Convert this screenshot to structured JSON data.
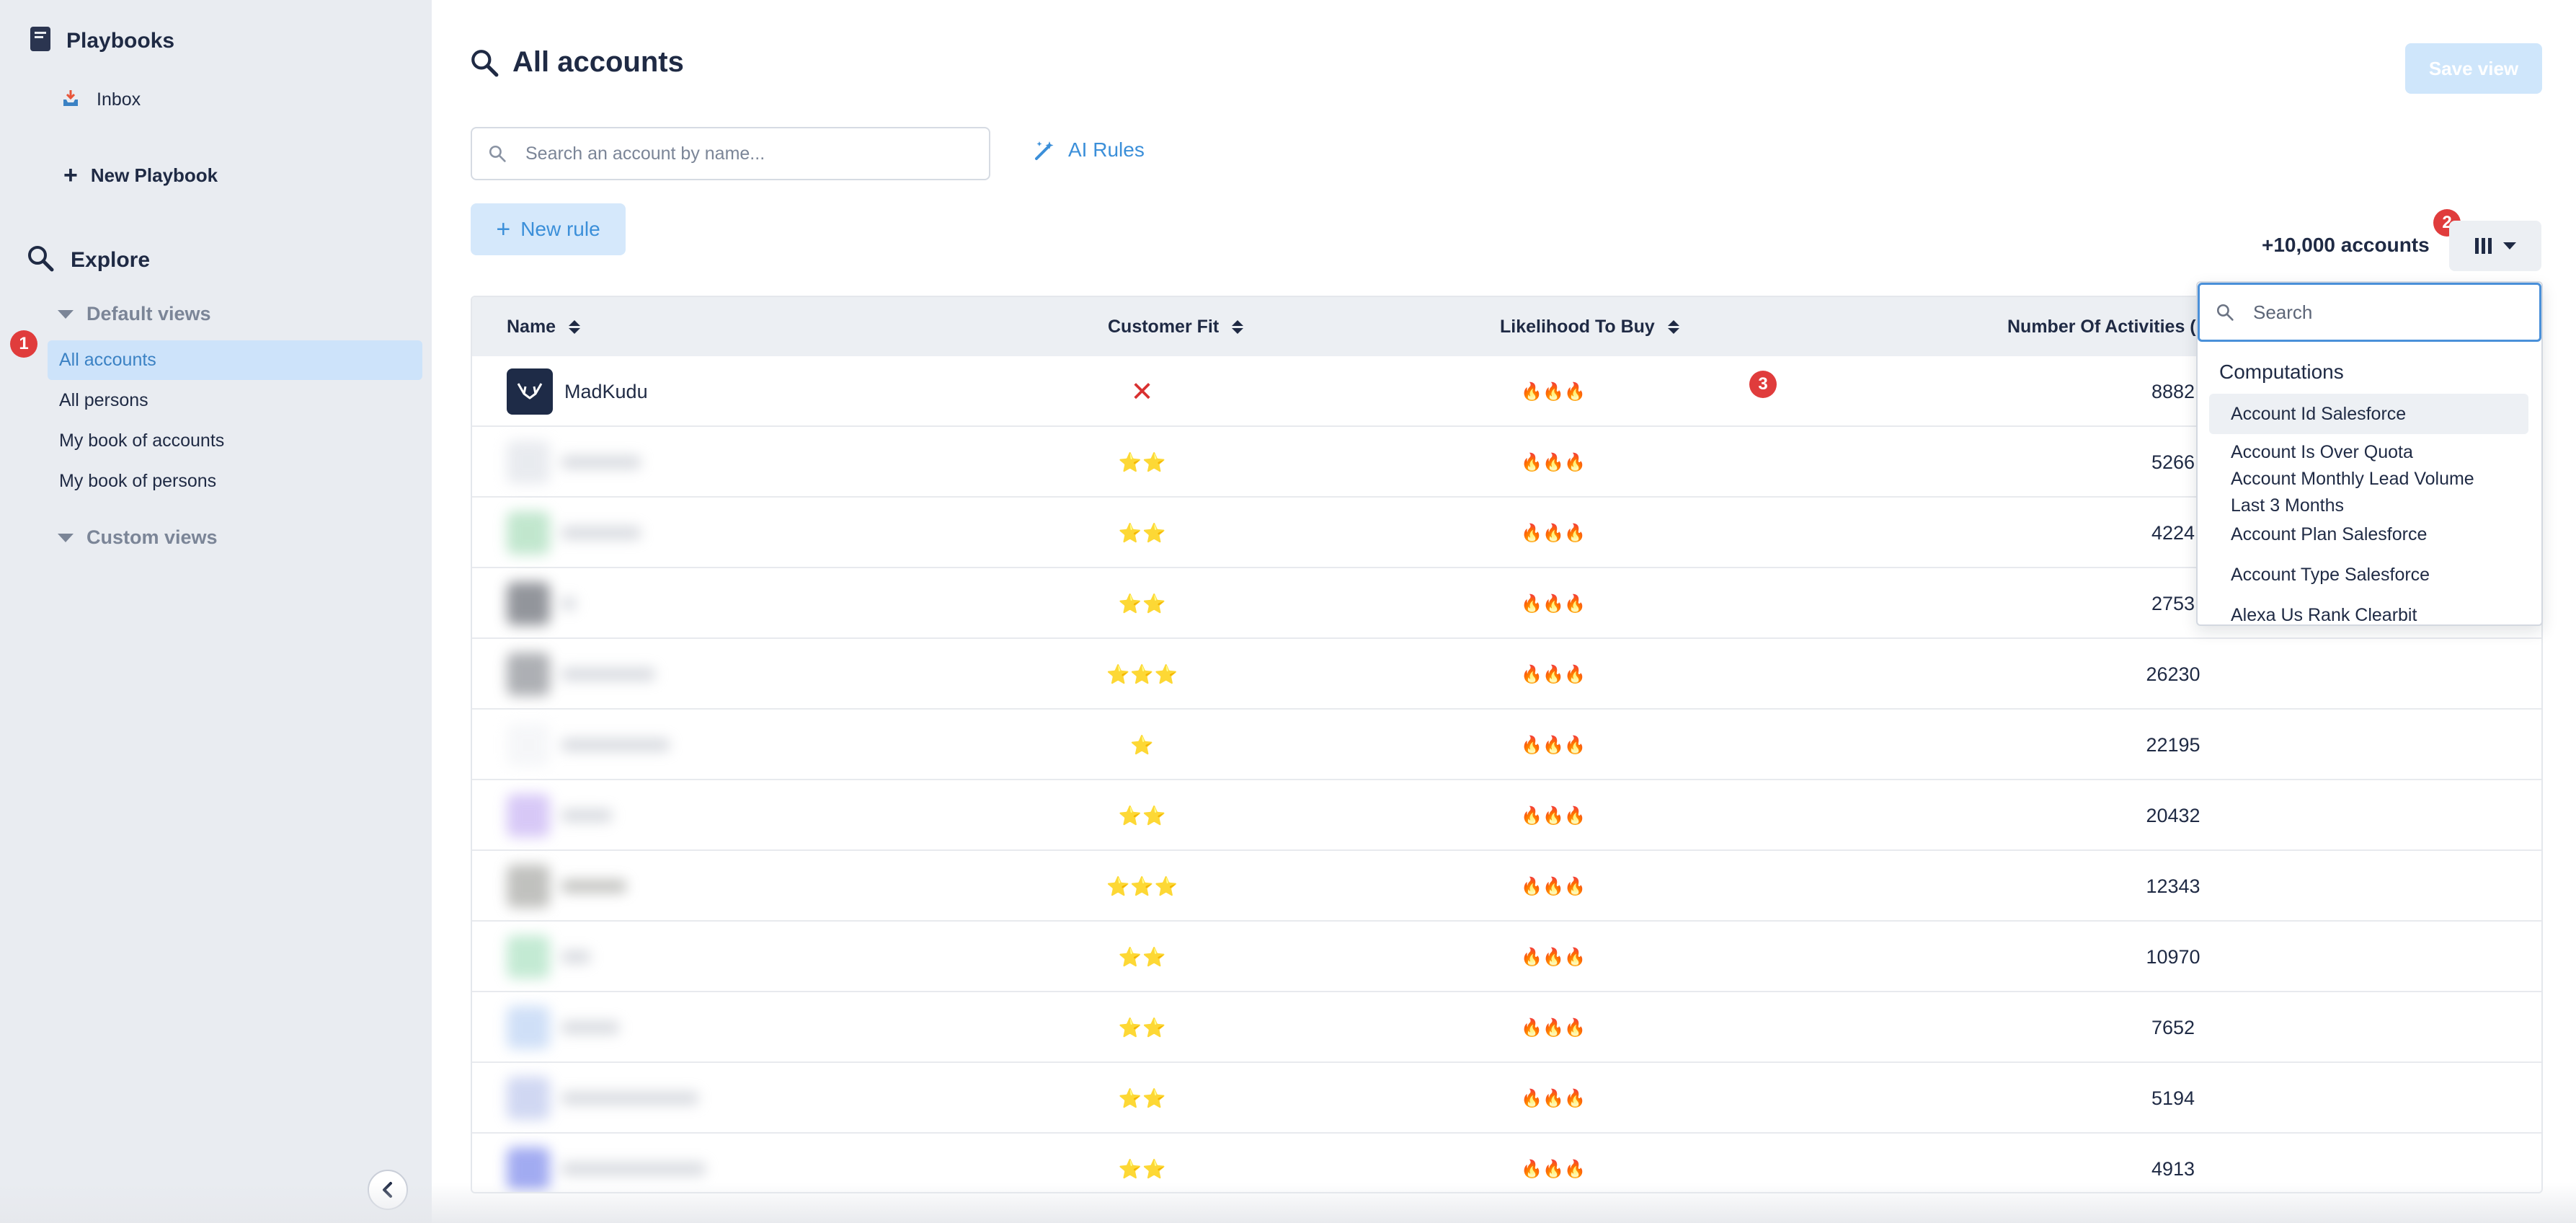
{
  "colors": {
    "accent": "#3b8fd9",
    "active_bg": "#cde3fa",
    "badge": "#e03c3c",
    "sidebar_bg": "#e9ecf1",
    "top_line": "#3fae8c"
  },
  "sidebar": {
    "playbooks_title": "Playbooks",
    "inbox_label": "Inbox",
    "new_playbook_label": "New Playbook",
    "explore_title": "Explore",
    "default_views_label": "Default views",
    "default_views": [
      "All accounts",
      "All persons",
      "My book of accounts",
      "My book of persons"
    ],
    "custom_views_label": "Custom views"
  },
  "badges": [
    "1",
    "2",
    "3"
  ],
  "header": {
    "title": "All accounts",
    "save_view_label": "Save view"
  },
  "toolbar": {
    "search_placeholder": "Search an account by name...",
    "ai_rules_label": "AI Rules",
    "new_rule_label": "New rule",
    "account_count": "+10,000 accounts"
  },
  "table": {
    "columns": [
      "Name",
      "Customer Fit",
      "Likelihood To Buy",
      "Number Of Activities ("
    ],
    "rows": [
      {
        "name": "MadKudu",
        "fit": "✕",
        "likelihood": "🔥🔥🔥",
        "activities": "8882"
      },
      {
        "name": "",
        "fit": "⭐⭐",
        "likelihood": "🔥🔥🔥",
        "activities": "5266"
      },
      {
        "name": "",
        "fit": "⭐⭐",
        "likelihood": "🔥🔥🔥",
        "activities": "4224"
      },
      {
        "name": "",
        "fit": "⭐⭐",
        "likelihood": "🔥🔥🔥",
        "activities": "2753"
      },
      {
        "name": "",
        "fit": "⭐⭐⭐",
        "likelihood": "🔥🔥🔥",
        "activities": "26230"
      },
      {
        "name": "",
        "fit": "⭐",
        "likelihood": "🔥🔥🔥",
        "activities": "22195"
      },
      {
        "name": "",
        "fit": "⭐⭐",
        "likelihood": "🔥🔥🔥",
        "activities": "20432"
      },
      {
        "name": "",
        "fit": "⭐⭐⭐",
        "likelihood": "🔥🔥🔥",
        "activities": "12343"
      },
      {
        "name": "",
        "fit": "⭐⭐",
        "likelihood": "🔥🔥🔥",
        "activities": "10970"
      },
      {
        "name": "",
        "fit": "⭐⭐",
        "likelihood": "🔥🔥🔥",
        "activities": "7652"
      },
      {
        "name": "",
        "fit": "⭐⭐",
        "likelihood": "🔥🔥🔥",
        "activities": "5194"
      },
      {
        "name": "",
        "fit": "⭐⭐",
        "likelihood": "🔥🔥🔥",
        "activities": "4913"
      }
    ]
  },
  "column_picker": {
    "search_placeholder": "Search",
    "group_label": "Computations",
    "items": [
      "Account Id Salesforce",
      "Account Is Over Quota",
      "Account Monthly Lead Volume\nLast 3 Months",
      "Account Plan Salesforce",
      "Account Type Salesforce",
      "Alexa Us Rank Clearbit"
    ]
  },
  "icons": {
    "playbooks": "book-icon",
    "inbox": "inbox-icon",
    "new_playbook": "plus-icon",
    "explore": "search-icon",
    "ai_rules": "magic-wand-icon",
    "columns": "columns-icon",
    "collapse": "chevron-left-icon"
  }
}
